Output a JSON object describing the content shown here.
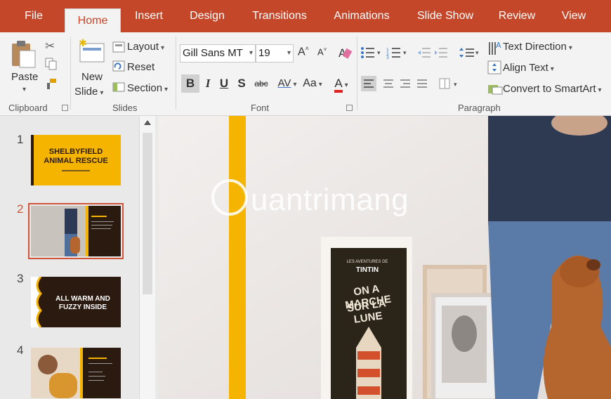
{
  "tabs": [
    {
      "label": "File"
    },
    {
      "label": "Home"
    },
    {
      "label": "Insert"
    },
    {
      "label": "Design"
    },
    {
      "label": "Transitions"
    },
    {
      "label": "Animations"
    },
    {
      "label": "Slide Show"
    },
    {
      "label": "Review"
    },
    {
      "label": "View"
    }
  ],
  "ribbon": {
    "clipboard": {
      "paste": "Paste",
      "label": "Clipboard"
    },
    "slides": {
      "new_slide_1": "New",
      "new_slide_2": "Slide",
      "layout": "Layout",
      "reset": "Reset",
      "section": "Section",
      "label": "Slides"
    },
    "font": {
      "name": "Gill Sans MT",
      "size": "19",
      "label": "Font",
      "bold": "B",
      "italic": "I",
      "underline": "U",
      "shadow": "S",
      "strike": "abc",
      "spacing": "AV",
      "case": "Aa",
      "color": "A"
    },
    "paragraph": {
      "text_direction": "Text Direction",
      "align_text": "Align Text",
      "smartart": "Convert to SmartArt",
      "label": "Paragraph"
    }
  },
  "slides": [
    {
      "num": "1",
      "line1": "SHELBYFIELD",
      "line2": "ANIMAL RESCUE"
    },
    {
      "num": "2"
    },
    {
      "num": "3",
      "line1": "ALL WARM AND",
      "line2": "FUZZY INSIDE"
    },
    {
      "num": "4"
    }
  ],
  "canvas": {
    "poster_line0": "LES AVENTURES DE",
    "poster_line1": "TINTIN",
    "poster_line2": "ON A MARCHE",
    "poster_line3": "SUR LA LUNE",
    "watermark": "uantrimang"
  },
  "colors": {
    "accent": "#c5472a",
    "slide_orange": "#f5b400",
    "slide_dark": "#2b1a10"
  },
  "icons": [
    "cut-icon",
    "copy-icon",
    "format-painter-icon",
    "new-slide-icon",
    "layout-icon",
    "reset-icon",
    "section-icon",
    "grow-font-icon",
    "shrink-font-icon",
    "clear-format-icon",
    "bullets-icon",
    "numbering-icon",
    "decrease-indent-icon",
    "increase-indent-icon",
    "line-spacing-icon",
    "text-direction-icon",
    "align-text-icon",
    "smartart-icon",
    "align-left-icon",
    "center-icon",
    "align-right-icon",
    "justify-icon",
    "columns-icon"
  ]
}
